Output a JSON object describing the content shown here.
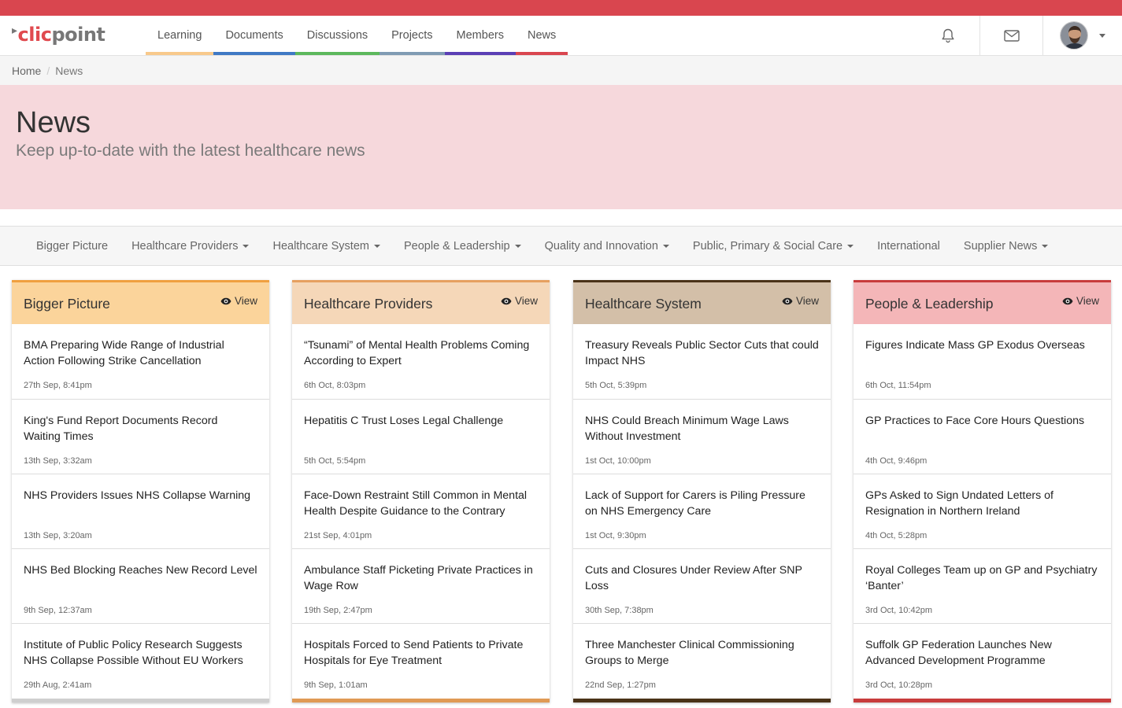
{
  "app": {
    "logo_prefix": "clic",
    "logo_suffix": "point"
  },
  "nav": [
    {
      "label": "Learning",
      "color": "#f8c98b"
    },
    {
      "label": "Documents",
      "color": "#3f79c4"
    },
    {
      "label": "Discussions",
      "color": "#5cb85c"
    },
    {
      "label": "Projects",
      "color": "#7f9bb3"
    },
    {
      "label": "Members",
      "color": "#5b3fb5"
    },
    {
      "label": "News",
      "color": "#d9464f"
    }
  ],
  "nav_icons": {
    "notifications": "bell-icon",
    "messages": "envelope-icon",
    "user": "avatar"
  },
  "breadcrumb": {
    "home": "Home",
    "separator": "/",
    "current": "News"
  },
  "hero": {
    "title": "News",
    "subtitle": "Keep up-to-date with the latest healthcare news"
  },
  "categories": [
    {
      "label": "Bigger Picture",
      "dropdown": false
    },
    {
      "label": "Healthcare Providers",
      "dropdown": true
    },
    {
      "label": "Healthcare System",
      "dropdown": true
    },
    {
      "label": "People & Leadership",
      "dropdown": true
    },
    {
      "label": "Quality and Innovation",
      "dropdown": true
    },
    {
      "label": "Public, Primary & Social Care",
      "dropdown": true
    },
    {
      "label": "International",
      "dropdown": false
    },
    {
      "label": "Supplier News",
      "dropdown": true
    }
  ],
  "view_label": "View",
  "columns": [
    {
      "title": "Bigger Picture",
      "head_bg": "#fbd49b",
      "accent": "#f0a040",
      "foot": "#cfcfcf",
      "items": [
        {
          "title": "BMA Preparing Wide Range of Industrial Action Following Strike Cancellation",
          "date": "27th Sep, 8:41pm"
        },
        {
          "title": "King's Fund Report Documents Record Waiting Times",
          "date": "13th Sep, 3:32am"
        },
        {
          "title": "NHS Providers Issues NHS Collapse Warning",
          "date": "13th Sep, 3:20am"
        },
        {
          "title": "NHS Bed Blocking Reaches New Record Level",
          "date": "9th Sep, 12:37am"
        },
        {
          "title": "Institute of Public Policy Research Suggests NHS Collapse Possible Without EU Workers",
          "date": "29th Aug, 2:41am"
        }
      ]
    },
    {
      "title": "Healthcare Providers",
      "head_bg": "#f5d7b8",
      "accent": "#e6a060",
      "foot": "#e09a55",
      "items": [
        {
          "title": "“Tsunami” of Mental Health Problems Coming According to Expert",
          "date": "6th Oct, 8:03pm"
        },
        {
          "title": "Hepatitis C Trust Loses Legal Challenge",
          "date": "5th Oct, 5:54pm"
        },
        {
          "title": "Face-Down Restraint Still Common in Mental Health Despite Guidance to the Contrary",
          "date": "21st Sep, 4:01pm"
        },
        {
          "title": "Ambulance Staff Picketing Private Practices in Wage Row",
          "date": "19th Sep, 2:47pm"
        },
        {
          "title": "Hospitals Forced to Send Patients to Private Hospitals for Eye Treatment",
          "date": "9th Sep, 1:01am"
        }
      ]
    },
    {
      "title": "Healthcare System",
      "head_bg": "#d3bfa8",
      "accent": "#4a3318",
      "foot": "#4a3318",
      "items": [
        {
          "title": "Treasury Reveals Public Sector Cuts that could Impact NHS",
          "date": "5th Oct, 5:39pm"
        },
        {
          "title": "NHS Could Breach Minimum Wage Laws Without Investment",
          "date": "1st Oct, 10:00pm"
        },
        {
          "title": "Lack of Support for Carers is Piling Pressure on NHS Emergency Care",
          "date": "1st Oct, 9:30pm"
        },
        {
          "title": "Cuts and Closures Under Review After SNP Loss",
          "date": "30th Sep, 7:38pm"
        },
        {
          "title": "Three Manchester Clinical Commissioning Groups to Merge",
          "date": "22nd Sep, 1:27pm"
        }
      ]
    },
    {
      "title": "People & Leadership",
      "head_bg": "#f4b6b8",
      "accent": "#c83c3c",
      "foot": "#c83c3c",
      "items": [
        {
          "title": "Figures Indicate Mass GP Exodus Overseas",
          "date": "6th Oct, 11:54pm"
        },
        {
          "title": "GP Practices to Face Core Hours Questions",
          "date": "4th Oct, 9:46pm"
        },
        {
          "title": "GPs Asked to Sign Undated Letters of Resignation in Northern Ireland",
          "date": "4th Oct, 5:28pm"
        },
        {
          "title": "Royal Colleges Team up on GP and Psychiatry ‘Banter’",
          "date": "3rd Oct, 10:42pm"
        },
        {
          "title": "Suffolk GP Federation Launches New Advanced Development Programme",
          "date": "3rd Oct, 10:28pm"
        }
      ]
    }
  ]
}
